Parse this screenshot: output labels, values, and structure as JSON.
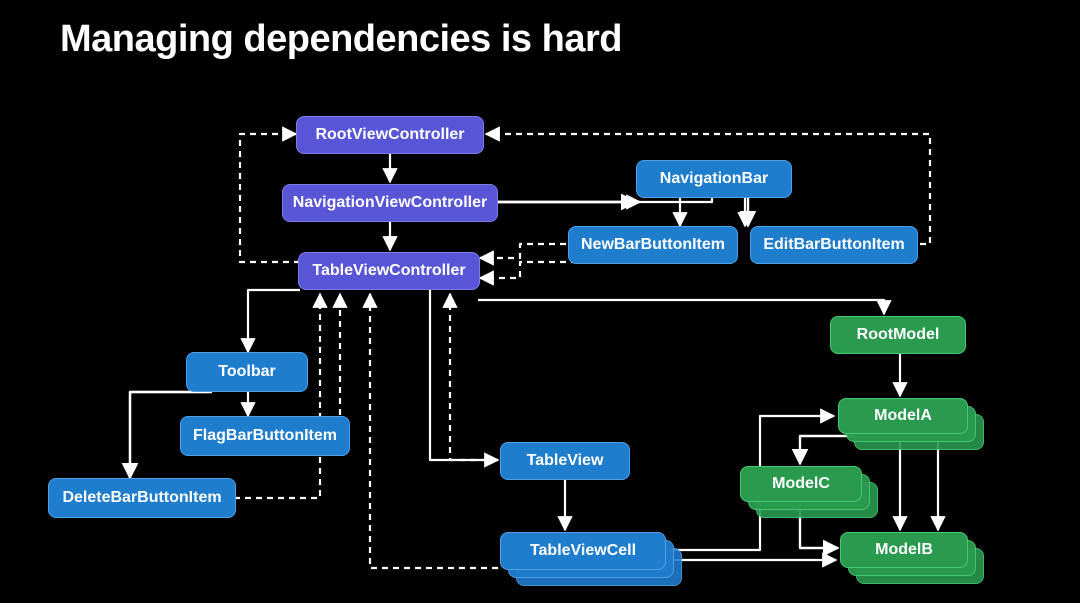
{
  "slide": {
    "title": "Managing dependencies is hard"
  },
  "colors": {
    "purple": "#5856D7",
    "blue": "#1f7dce",
    "green": "#2a9a4f",
    "bg": "#000000"
  },
  "nodes": {
    "rootViewController": "RootViewController",
    "navigationViewController": "NavigationViewController",
    "tableViewController": "TableViewController",
    "navigationBar": "NavigationBar",
    "newBarButtonItem": "NewBarButtonItem",
    "editBarButtonItem": "EditBarButtonItem",
    "toolbar": "Toolbar",
    "flagBarButtonItem": "FlagBarButtonItem",
    "deleteBarButtonItem": "DeleteBarButtonItem",
    "tableView": "TableView",
    "tableViewCell": "TableViewCell",
    "rootModel": "RootModel",
    "modelA": "ModelA",
    "modelB": "ModelB",
    "modelC": "ModelC"
  },
  "edges": {
    "solid": [
      [
        "rootViewController",
        "navigationViewController"
      ],
      [
        "navigationViewController",
        "tableViewController"
      ],
      [
        "navigationViewController",
        "navigationBar"
      ],
      [
        "navigationBar",
        "newBarButtonItem"
      ],
      [
        "navigationBar",
        "editBarButtonItem"
      ],
      [
        "tableViewController",
        "toolbar"
      ],
      [
        "toolbar",
        "flagBarButtonItem"
      ],
      [
        "toolbar",
        "deleteBarButtonItem"
      ],
      [
        "tableViewController",
        "tableView"
      ],
      [
        "tableView",
        "tableViewCell"
      ],
      [
        "tableViewController",
        "rootModel"
      ],
      [
        "rootModel",
        "modelA"
      ],
      [
        "modelA",
        "modelC"
      ],
      [
        "modelA",
        "modelB"
      ],
      [
        "modelC",
        "modelB"
      ],
      [
        "tableViewCell",
        "modelA"
      ],
      [
        "tableViewCell",
        "modelB"
      ]
    ],
    "dashed": [
      [
        "tableViewController",
        "rootViewController"
      ],
      [
        "editBarButtonItem",
        "rootViewController"
      ],
      [
        "newBarButtonItem",
        "tableViewController"
      ],
      [
        "editBarButtonItem",
        "tableViewController"
      ],
      [
        "flagBarButtonItem",
        "tableViewController"
      ],
      [
        "deleteBarButtonItem",
        "tableViewController"
      ],
      [
        "tableView",
        "tableViewController"
      ],
      [
        "tableViewCell",
        "tableViewController"
      ]
    ]
  }
}
